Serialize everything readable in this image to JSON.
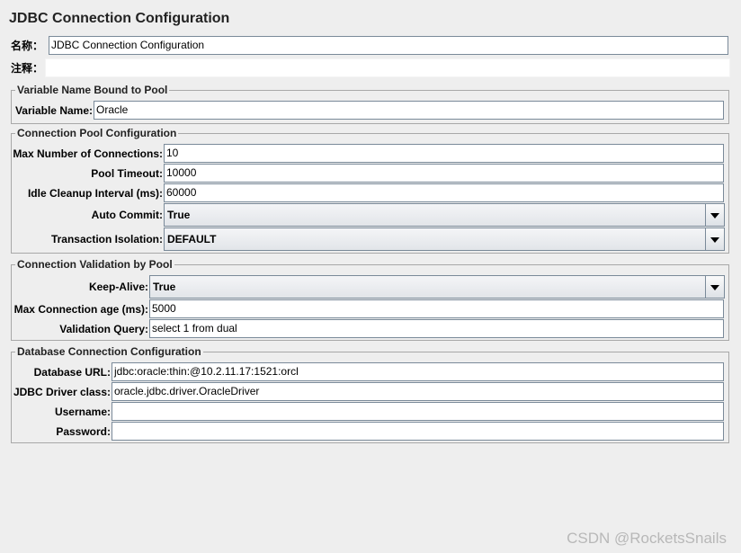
{
  "title": "JDBC Connection Configuration",
  "header": {
    "name_label": "名称：",
    "name_value": "JDBC Connection Configuration",
    "comment_label": "注释：",
    "comment_value": ""
  },
  "variable_group": {
    "legend": "Variable Name Bound to Pool",
    "variable_name_label": "Variable Name:",
    "variable_name_value": "Oracle"
  },
  "pool_group": {
    "legend": "Connection Pool Configuration",
    "max_connections_label": "Max Number of Connections:",
    "max_connections_value": "10",
    "pool_timeout_label": "Pool Timeout:",
    "pool_timeout_value": "10000",
    "idle_cleanup_label": "Idle Cleanup Interval (ms):",
    "idle_cleanup_value": "60000",
    "auto_commit_label": "Auto Commit:",
    "auto_commit_value": "True",
    "transaction_isolation_label": "Transaction Isolation:",
    "transaction_isolation_value": "DEFAULT"
  },
  "validation_group": {
    "legend": "Connection Validation by Pool",
    "keep_alive_label": "Keep-Alive:",
    "keep_alive_value": "True",
    "max_age_label": "Max Connection age (ms):",
    "max_age_value": "5000",
    "validation_query_label": "Validation Query:",
    "validation_query_value": "select 1 from dual"
  },
  "database_group": {
    "legend": "Database Connection Configuration",
    "url_label": "Database URL:",
    "url_value": "jdbc:oracle:thin:@10.2.11.17:1521:orcl",
    "driver_label": "JDBC Driver class:",
    "driver_value": "oracle.jdbc.driver.OracleDriver",
    "username_label": "Username:",
    "username_value": "",
    "password_label": "Password:",
    "password_value": ""
  },
  "watermark": "CSDN @RocketsSnails",
  "colors": {
    "background": "#eeeeee",
    "field_border": "#7a8a99",
    "group_border": "#a8a8a8"
  }
}
